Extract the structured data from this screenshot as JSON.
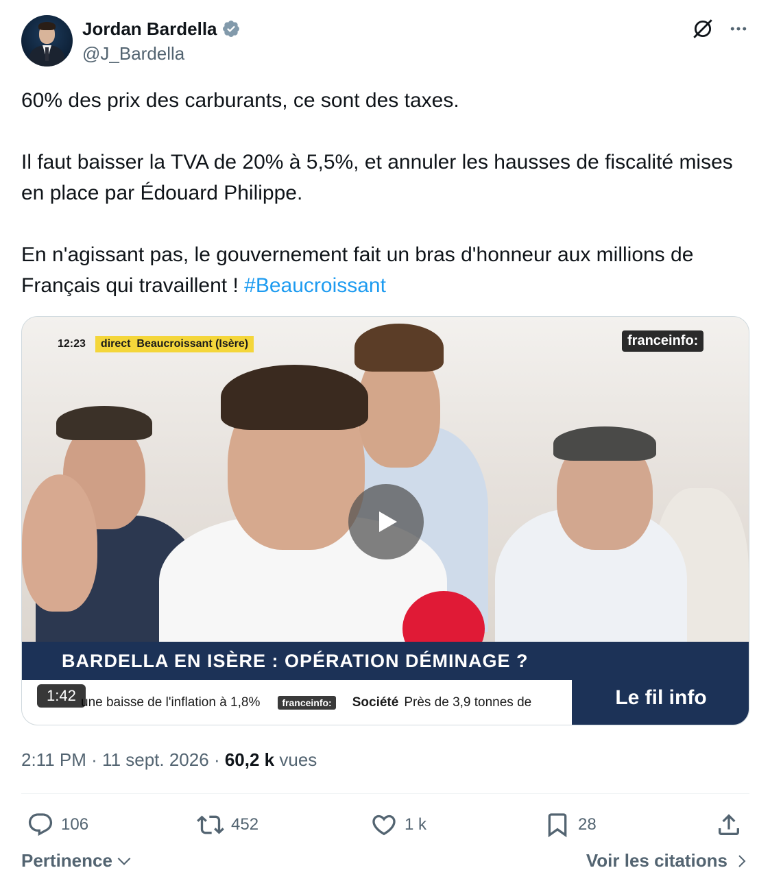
{
  "author": {
    "name": "Jordan Bardella",
    "handle": "@J_Bardella",
    "verified_icon": "verified-badge-icon",
    "avatar_icon": "avatar"
  },
  "header_actions": {
    "grok_icon": "grok-icon",
    "more_icon": "more-icon"
  },
  "tweet": {
    "paragraphs": [
      "60% des prix des carburants, ce sont des taxes.",
      "Il faut baisser la TVA de 20% à 5,5%, et annuler les hausses de fiscalité mises en place par Édouard Philippe.",
      "En n'agissant pas, le gouvernement fait un bras d'honneur aux millions de Français qui travaillent !"
    ],
    "hashtag": "#Beaucroissant"
  },
  "video": {
    "live_time": "12:23",
    "live_label": "direct",
    "live_location": "Beaucroissant (Isère)",
    "channel_logo": "franceinfo:",
    "banner": "BARDELLA EN ISÈRE : OPÉRATION DÉMINAGE  ?",
    "ticker_left": "une baisse de l'inflation à 1,8%",
    "ticker_logo": "franceinfo:",
    "ticker_category": "Société",
    "ticker_right": "Près de 3,9 tonnes de",
    "side_panel": "Le fil info",
    "duration": "1:42",
    "play_icon": "play-icon"
  },
  "meta": {
    "time": "2:11 PM",
    "separator": "·",
    "date": "11 sept. 2026",
    "views_count": "60,2 k",
    "views_label": "vues"
  },
  "actions": {
    "replies": "106",
    "reposts": "452",
    "likes": "1 k",
    "bookmarks": "28"
  },
  "footer": {
    "sort_label": "Pertinence",
    "quotes_label": "Voir les citations"
  },
  "colors": {
    "accent": "#1d9bf0",
    "text": "#0f1419",
    "secondary": "#536471",
    "banner": "#1c3257"
  }
}
